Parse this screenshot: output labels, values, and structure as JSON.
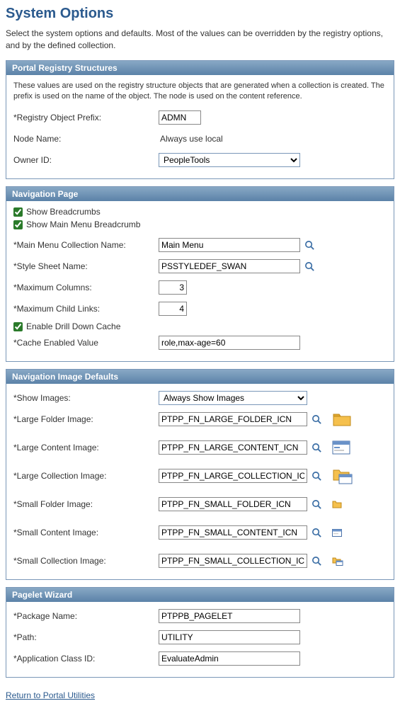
{
  "page": {
    "title": "System Options",
    "intro": "Select the system options and defaults. Most of the values can be overridden by the registry options, and by the defined collection."
  },
  "registry": {
    "header": "Portal Registry Structures",
    "desc": "These values are used on the registry structure objects that are generated when a collection is created. The prefix is used on the name of the object. The node is used on the content reference.",
    "prefix_label": "*Registry Object Prefix:",
    "prefix_value": "ADMN",
    "node_label": "Node Name:",
    "node_value": "Always use local",
    "owner_label": "Owner ID:",
    "owner_value": "PeopleTools"
  },
  "nav": {
    "header": "Navigation Page",
    "show_bc_label": "Show Breadcrumbs",
    "show_bc_checked": true,
    "show_mm_bc_label": "Show Main Menu Breadcrumb",
    "show_mm_bc_checked": true,
    "mm_coll_label": "*Main Menu Collection Name:",
    "mm_coll_value": "Main Menu",
    "style_label": "*Style Sheet Name:",
    "style_value": "PSSTYLEDEF_SWAN",
    "max_cols_label": "*Maximum Columns:",
    "max_cols_value": "3",
    "max_child_label": "*Maximum Child Links:",
    "max_child_value": "4",
    "drill_label": "Enable Drill Down Cache",
    "drill_checked": true,
    "cache_label": "*Cache Enabled Value",
    "cache_value": "role,max-age=60"
  },
  "imgdef": {
    "header": "Navigation Image Defaults",
    "show_label": "*Show Images:",
    "show_value": "Always Show Images",
    "lg_folder_label": "*Large Folder Image:",
    "lg_folder_value": "PTPP_FN_LARGE_FOLDER_ICN",
    "lg_content_label": "*Large Content Image:",
    "lg_content_value": "PTPP_FN_LARGE_CONTENT_ICN",
    "lg_coll_label": "*Large Collection Image:",
    "lg_coll_value": "PTPP_FN_LARGE_COLLECTION_ICN",
    "sm_folder_label": "*Small Folder Image:",
    "sm_folder_value": "PTPP_FN_SMALL_FOLDER_ICN",
    "sm_content_label": "*Small Content Image:",
    "sm_content_value": "PTPP_FN_SMALL_CONTENT_ICN",
    "sm_coll_label": "*Small Collection Image:",
    "sm_coll_value": "PTPP_FN_SMALL_COLLECTION_ICN"
  },
  "pagelet": {
    "header": "Pagelet Wizard",
    "pkg_label": "*Package Name:",
    "pkg_value": "PTPPB_PAGELET",
    "path_label": "*Path:",
    "path_value": "UTILITY",
    "app_label": "*Application Class ID:",
    "app_value": "EvaluateAdmin"
  },
  "footer": {
    "return_link": "Return to Portal Utilities"
  }
}
